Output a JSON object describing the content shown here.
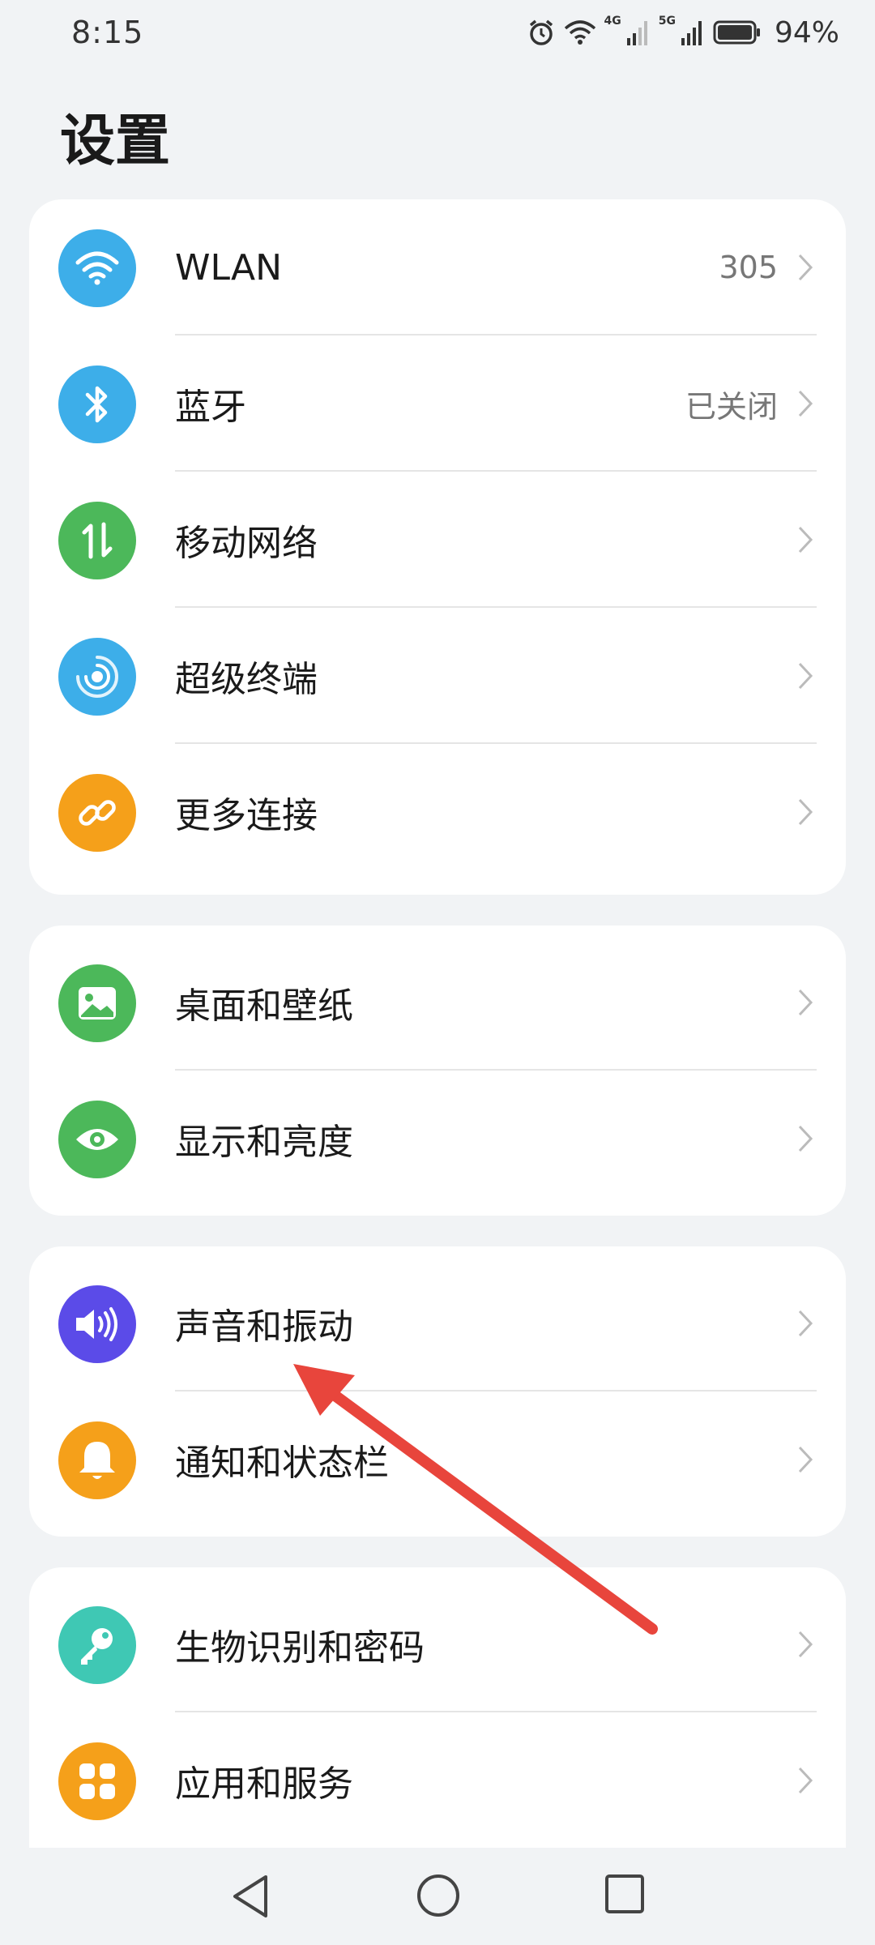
{
  "status_bar": {
    "time": "8:15",
    "network_4g": "4G",
    "network_5g": "5G",
    "battery_percent": "94%"
  },
  "page": {
    "title": "设置"
  },
  "groups": [
    {
      "items": [
        {
          "label": "WLAN",
          "value": "305",
          "icon": "wifi-icon",
          "color": "#3daee9"
        },
        {
          "label": "蓝牙",
          "value": "已关闭",
          "icon": "bluetooth-icon",
          "color": "#3daee9"
        },
        {
          "label": "移动网络",
          "value": "",
          "icon": "mobile-data-icon",
          "color": "#4cb85a"
        },
        {
          "label": "超级终端",
          "value": "",
          "icon": "super-device-icon",
          "color": "#3daee9"
        },
        {
          "label": "更多连接",
          "value": "",
          "icon": "link-icon",
          "color": "#f5a01a"
        }
      ]
    },
    {
      "items": [
        {
          "label": "桌面和壁纸",
          "value": "",
          "icon": "wallpaper-icon",
          "color": "#4cb85a"
        },
        {
          "label": "显示和亮度",
          "value": "",
          "icon": "eye-icon",
          "color": "#4cb85a"
        }
      ]
    },
    {
      "items": [
        {
          "label": "声音和振动",
          "value": "",
          "icon": "speaker-icon",
          "color": "#5b4be8"
        },
        {
          "label": "通知和状态栏",
          "value": "",
          "icon": "bell-icon",
          "color": "#f5a01a"
        }
      ]
    },
    {
      "items": [
        {
          "label": "生物识别和密码",
          "value": "",
          "icon": "key-icon",
          "color": "#3fc8b4"
        },
        {
          "label": "应用和服务",
          "value": "",
          "icon": "apps-icon",
          "color": "#f5a01a"
        }
      ]
    }
  ],
  "annotation": {
    "arrow_color": "#e8453c",
    "points_to": "声音和振动"
  }
}
